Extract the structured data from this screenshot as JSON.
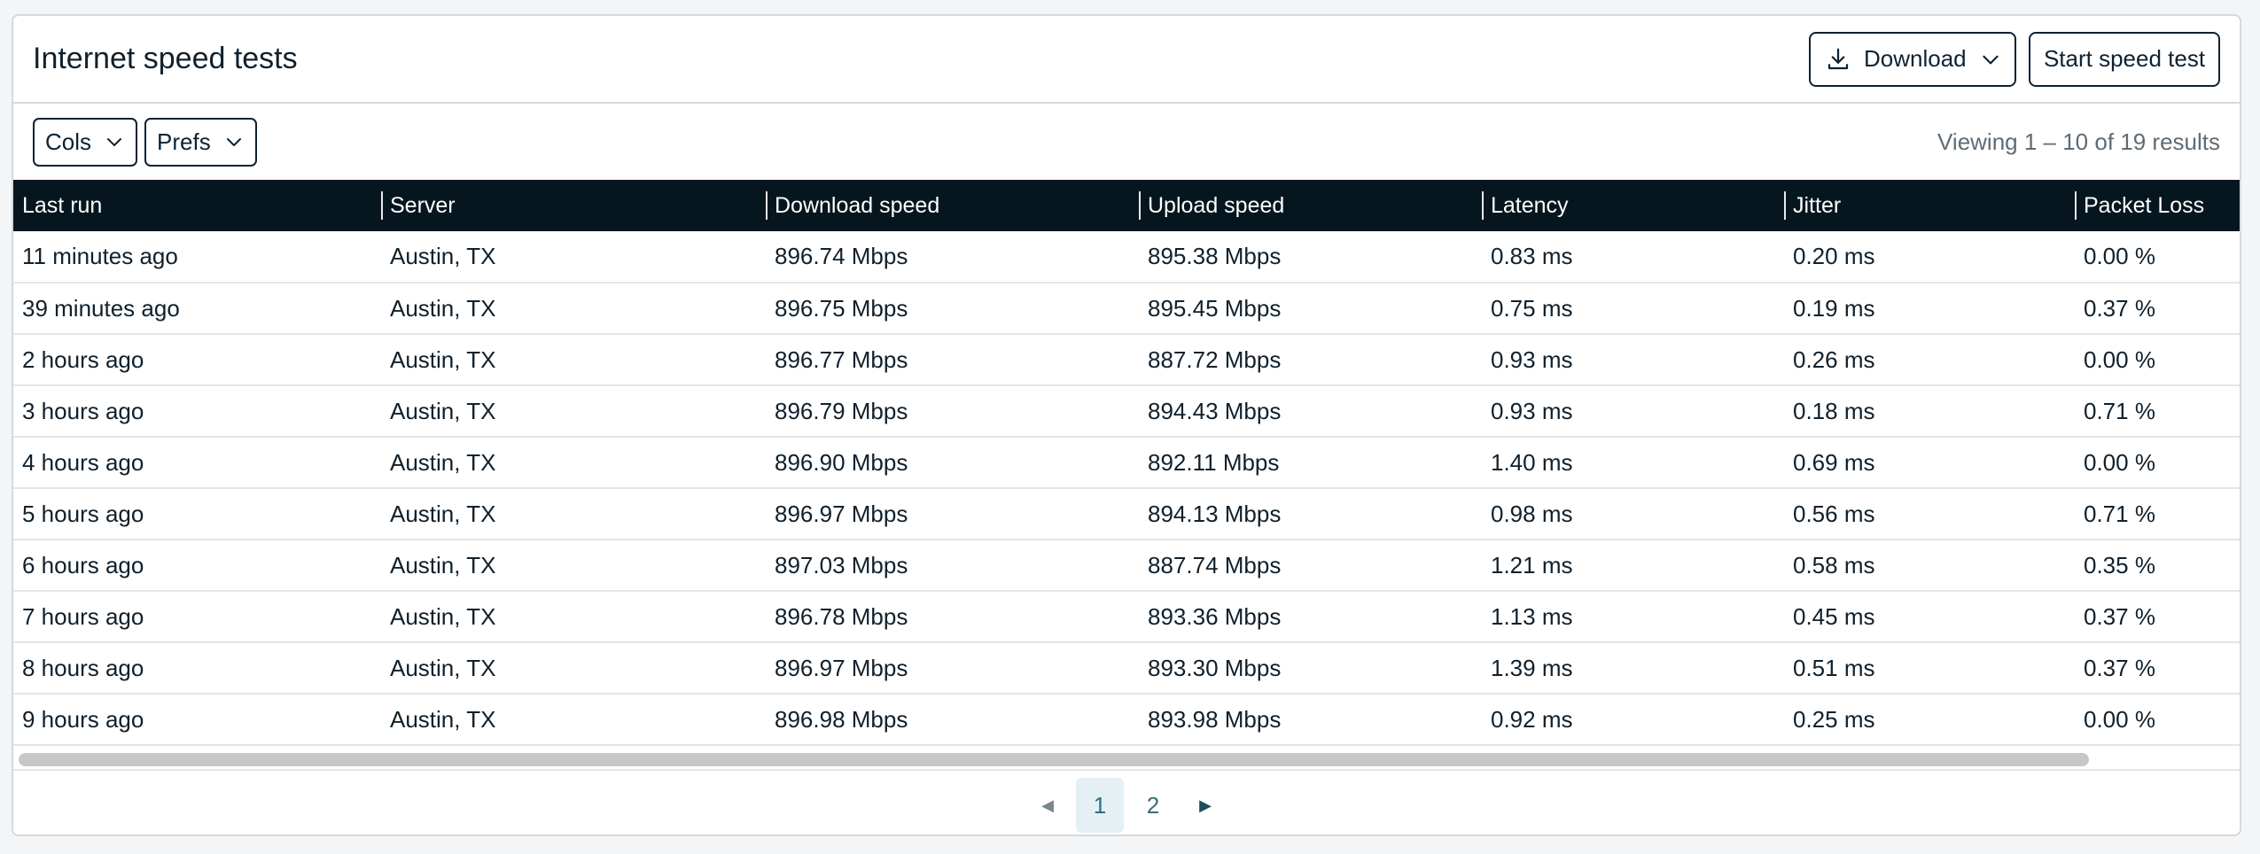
{
  "header": {
    "title": "Internet speed tests",
    "download_label": "Download",
    "start_label": "Start speed test"
  },
  "toolbar": {
    "cols_label": "Cols",
    "prefs_label": "Prefs",
    "viewing_text": "Viewing 1 – 10 of 19 results"
  },
  "table": {
    "columns": [
      "Last run",
      "Server",
      "Download speed",
      "Upload speed",
      "Latency",
      "Jitter",
      "Packet Loss"
    ],
    "rows": [
      [
        "11 minutes ago",
        "Austin, TX",
        "896.74 Mbps",
        "895.38 Mbps",
        "0.83 ms",
        "0.20 ms",
        "0.00 %"
      ],
      [
        "39 minutes ago",
        "Austin, TX",
        "896.75 Mbps",
        "895.45 Mbps",
        "0.75 ms",
        "0.19 ms",
        "0.37 %"
      ],
      [
        "2 hours ago",
        "Austin, TX",
        "896.77 Mbps",
        "887.72 Mbps",
        "0.93 ms",
        "0.26 ms",
        "0.00 %"
      ],
      [
        "3 hours ago",
        "Austin, TX",
        "896.79 Mbps",
        "894.43 Mbps",
        "0.93 ms",
        "0.18 ms",
        "0.71 %"
      ],
      [
        "4 hours ago",
        "Austin, TX",
        "896.90 Mbps",
        "892.11 Mbps",
        "1.40 ms",
        "0.69 ms",
        "0.00 %"
      ],
      [
        "5 hours ago",
        "Austin, TX",
        "896.97 Mbps",
        "894.13 Mbps",
        "0.98 ms",
        "0.56 ms",
        "0.71 %"
      ],
      [
        "6 hours ago",
        "Austin, TX",
        "897.03 Mbps",
        "887.74 Mbps",
        "1.21 ms",
        "0.58 ms",
        "0.35 %"
      ],
      [
        "7 hours ago",
        "Austin, TX",
        "896.78 Mbps",
        "893.36 Mbps",
        "1.13 ms",
        "0.45 ms",
        "0.37 %"
      ],
      [
        "8 hours ago",
        "Austin, TX",
        "896.97 Mbps",
        "893.30 Mbps",
        "1.39 ms",
        "0.51 ms",
        "0.37 %"
      ],
      [
        "9 hours ago",
        "Austin, TX",
        "896.98 Mbps",
        "893.98 Mbps",
        "0.92 ms",
        "0.25 ms",
        "0.00 %"
      ]
    ]
  },
  "pagination": {
    "prev": "◀",
    "next": "▶",
    "pages": [
      "1",
      "2"
    ],
    "current": "1"
  },
  "colors": {
    "header_bg": "#06161f",
    "button_border": "#0d2233",
    "active_page_bg": "#e4f0f4",
    "scrollbar": "#c7c7c7"
  },
  "icons": {
    "download": "download-icon",
    "dropdown": "chevron-down-icon"
  }
}
